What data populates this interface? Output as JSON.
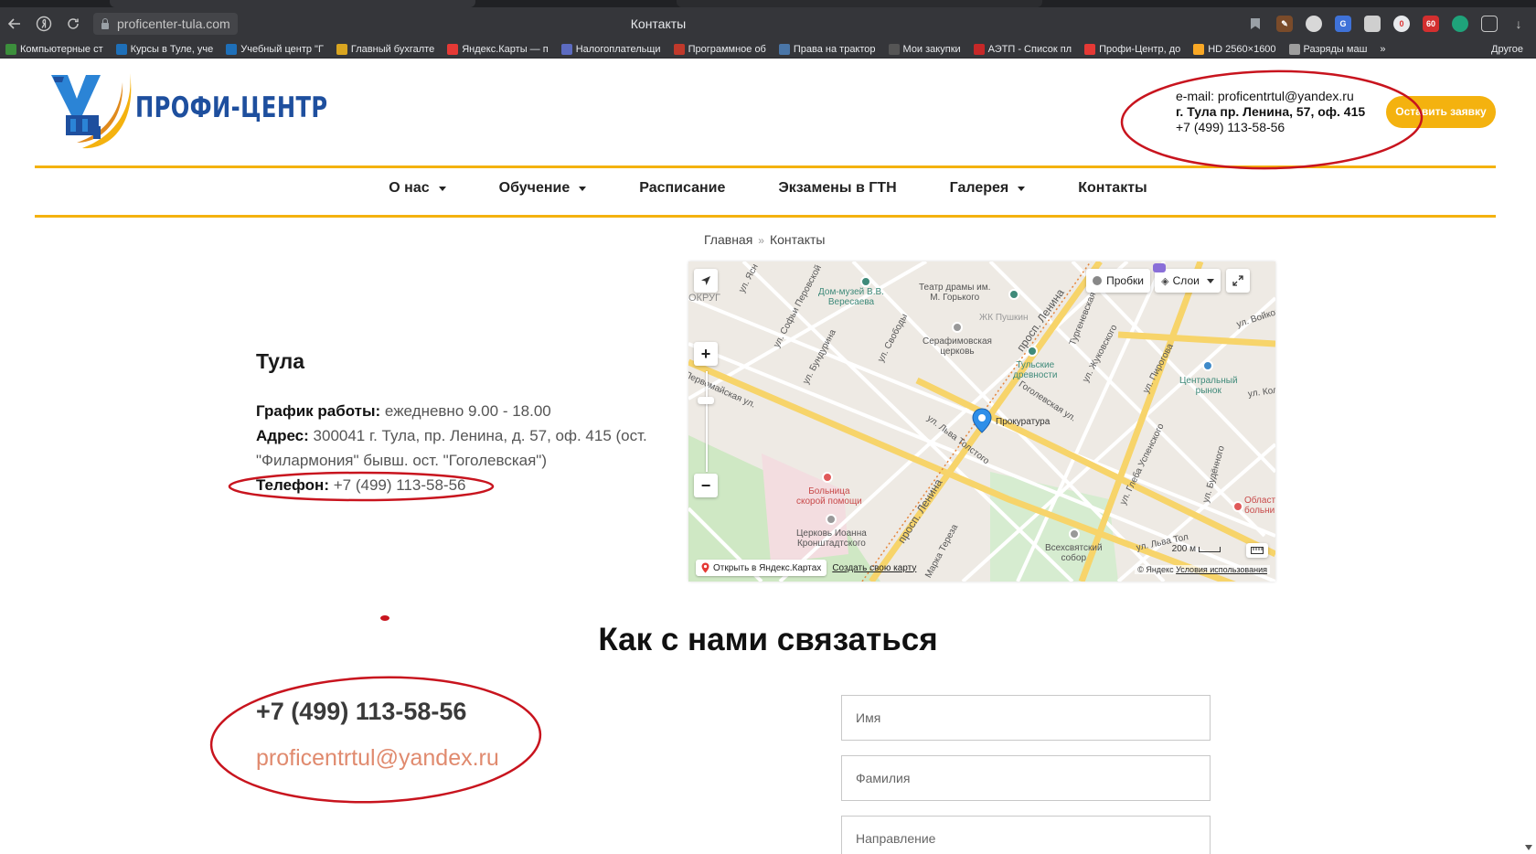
{
  "browser": {
    "url": "proficenter-tula.com",
    "window_title": "Контакты",
    "bookmarks": [
      {
        "label": "Компьютерные ст",
        "color": "#3c8f3c"
      },
      {
        "label": "Курсы в Туле, уче",
        "color": "#1e6fb8"
      },
      {
        "label": "Учебный центр \"Г",
        "color": "#1e6fb8"
      },
      {
        "label": "Главный бухгалте",
        "color": "#d9a520"
      },
      {
        "label": "Яндекс.Карты — п",
        "color": "#e53935"
      },
      {
        "label": "Налогоплательщи",
        "color": "#5c6bc0"
      },
      {
        "label": "Программное об",
        "color": "#c0392b"
      },
      {
        "label": "Права на трактор",
        "color": "#4a76a8"
      },
      {
        "label": "Мои закупки",
        "color": "#555555"
      },
      {
        "label": "АЭТП - Список пл",
        "color": "#c62828"
      },
      {
        "label": "Профи-Центр, до",
        "color": "#e53935"
      },
      {
        "label": "HD 2560×1600",
        "color": "#f9a825"
      },
      {
        "label": "Разряды маш",
        "color": "#9e9e9e"
      }
    ],
    "bookmarks_other": "Другое"
  },
  "site": {
    "logo_text": "ПРОФИ-ЦЕНТР",
    "header": {
      "email": "e-mail: proficentrtul@yandex.ru",
      "address": "г. Тула пр. Ленина, 57, оф. 415",
      "phone": "+7 (499) 113-58-56",
      "cta_label": "Оставить заявку"
    },
    "nav": [
      {
        "label": "О нас",
        "dropdown": true
      },
      {
        "label": "Обучение",
        "dropdown": true
      },
      {
        "label": "Расписание",
        "dropdown": false
      },
      {
        "label": "Экзамены в ГТН",
        "dropdown": false
      },
      {
        "label": "Галерея",
        "dropdown": true
      },
      {
        "label": "Контакты",
        "dropdown": false
      }
    ],
    "breadcrumb": {
      "home": "Главная",
      "sep": "»",
      "current": "Контакты"
    }
  },
  "office": {
    "city": "Тула",
    "hours_label": "График работы:",
    "hours_value": " ежедневно 9.00 - 18.00",
    "address_label": "Адрес:",
    "address_value": " 300041 г. Тула, пр. Ленина, д. 57, оф. 415 (ост. \"Филармония\" бывш. ост. \"Гоголевская\")",
    "phone_label": "Телефон:",
    "phone_value": " +7 (499) 113-58-56"
  },
  "map": {
    "traffic_label": "Пробки",
    "layers_label": "Слои",
    "open_label": "Открыть в Яндекс.Картах",
    "create_label": "Создать свою карту",
    "copyright": "© Яндекс ",
    "terms": "Условия использования",
    "scale": "200 м",
    "places": {
      "veresaev": "Дом-музей В.В.\nВересаева",
      "theatre": "Театр драмы им.\nМ. Горького",
      "pushkin": "ЖК Пушкин",
      "seraphim": "Серафимовская\nцерковь",
      "antiquity": "Тульские\nдревности",
      "market": "Центральный\nрынок",
      "prosecutor": "Прокуратура",
      "hospital": "Больница\nскорой помощи",
      "church": "Церковь Иоанна\nКронштадтского",
      "cathedral": "Всехсвятский\nсобор",
      "oblast": "Област\nбольни"
    },
    "streets": {
      "lenina1": "просп. Ленина",
      "lenina2": "просп. Ленина",
      "tolstogo": "ул. Льва Толстого",
      "tolstogo2": "ул. Льва Тол",
      "pervomayskaya": "Первомайская ул.",
      "gogolevskaya": "Гоголевская ул.",
      "perovskoy": "ул. Софьи Перовской",
      "bundurina": "ул. Бундурина",
      "svobody": "ул. Свободы",
      "turgenevskaya": "Тургеневская ул.",
      "zhukovskogo": "ул. Жуковского",
      "pirogova": "ул. Пирогова",
      "uspenskogo": "ул. Глеба Успенского",
      "budennogo": "ул. Будённого",
      "voykova": "ул. Войкова",
      "yasn": "ул. Ясн",
      "kol": "ул. Кол",
      "tereza": "Марка Тереза",
      "okrug": "ОКРУГ"
    }
  },
  "contact": {
    "title": "Как с нами связаться",
    "phone": "+7 (499) 113-58-56",
    "email": "proficentrtul@yandex.ru",
    "form": {
      "name_placeholder": "Имя",
      "surname_placeholder": "Фамилия",
      "direction_placeholder": "Направление"
    }
  },
  "colors": {
    "accent": "#f4b20f",
    "logo_blue": "#1e4f9e",
    "email_link": "#e08a6e",
    "annotation_red": "#c8141e"
  }
}
